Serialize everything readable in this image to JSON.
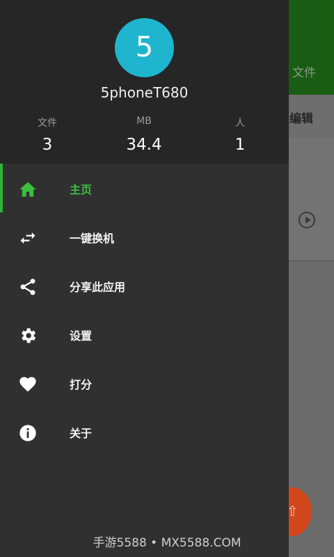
{
  "background": {
    "header_tab": "文件",
    "edit_label": "编辑"
  },
  "drawer": {
    "avatar_letter": "5",
    "username": "5phoneT680",
    "stats": [
      {
        "label": "文件",
        "value": "3"
      },
      {
        "label": "MB",
        "value": "34.4"
      },
      {
        "label": "人",
        "value": "1"
      }
    ],
    "menu": [
      {
        "label": "主页",
        "icon": "home-icon",
        "active": true
      },
      {
        "label": "一键换机",
        "icon": "swap-icon"
      },
      {
        "label": "分享此应用",
        "icon": "share-icon"
      },
      {
        "label": "设置",
        "icon": "gear-icon"
      },
      {
        "label": "打分",
        "icon": "heart-icon"
      },
      {
        "label": "关于",
        "icon": "info-icon"
      }
    ]
  },
  "watermark": "手游5588 • MX5588.COM",
  "colors": {
    "accent_green": "#2eb43a",
    "avatar_cyan": "#1fb5ce",
    "fab_orange": "#d3471c",
    "drawer_bg": "#303030"
  }
}
